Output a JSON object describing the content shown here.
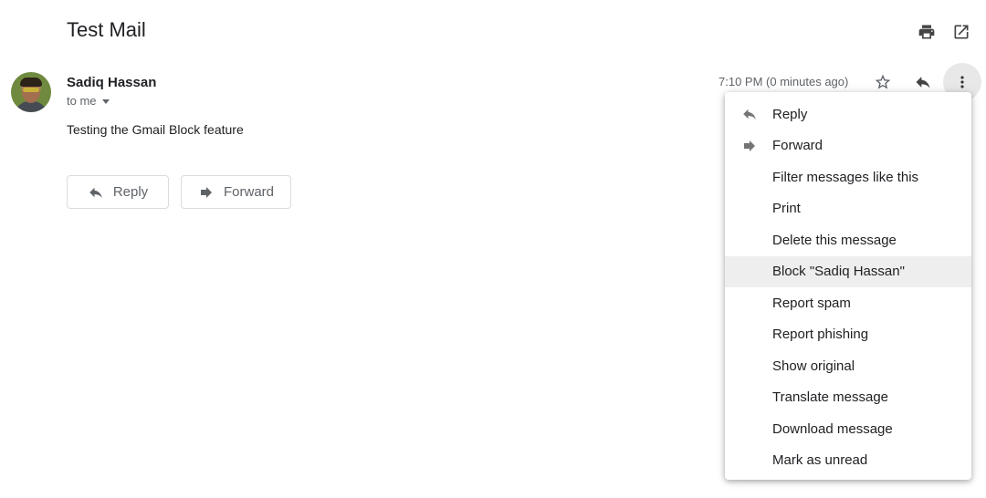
{
  "email": {
    "subject": "Test Mail",
    "sender_name": "Sadiq Hassan",
    "recipient_label": "to me",
    "body": "Testing the Gmail Block feature",
    "timestamp": "7:10 PM (0 minutes ago)"
  },
  "toolbar": {
    "print_icon": "print-icon",
    "open_new_window_icon": "open-in-new-window-icon"
  },
  "header_actions": {
    "star_icon": "star-icon",
    "reply_icon": "reply-icon",
    "more_icon": "more-vertical-icon"
  },
  "buttons": {
    "reply_label": "Reply",
    "forward_label": "Forward"
  },
  "menu": {
    "items": [
      {
        "label": "Reply",
        "icon": "reply-icon"
      },
      {
        "label": "Forward",
        "icon": "forward-icon"
      },
      {
        "label": "Filter messages like this"
      },
      {
        "label": "Print"
      },
      {
        "label": "Delete this message"
      },
      {
        "label": "Block \"Sadiq Hassan\"",
        "highlighted": true
      },
      {
        "label": "Report spam"
      },
      {
        "label": "Report phishing"
      },
      {
        "label": "Show original"
      },
      {
        "label": "Translate message"
      },
      {
        "label": "Download message"
      },
      {
        "label": "Mark as unread"
      }
    ]
  },
  "colors": {
    "menu_highlight": "#eeeeee",
    "secondary_text": "#5f6368",
    "primary_text": "#202124"
  }
}
